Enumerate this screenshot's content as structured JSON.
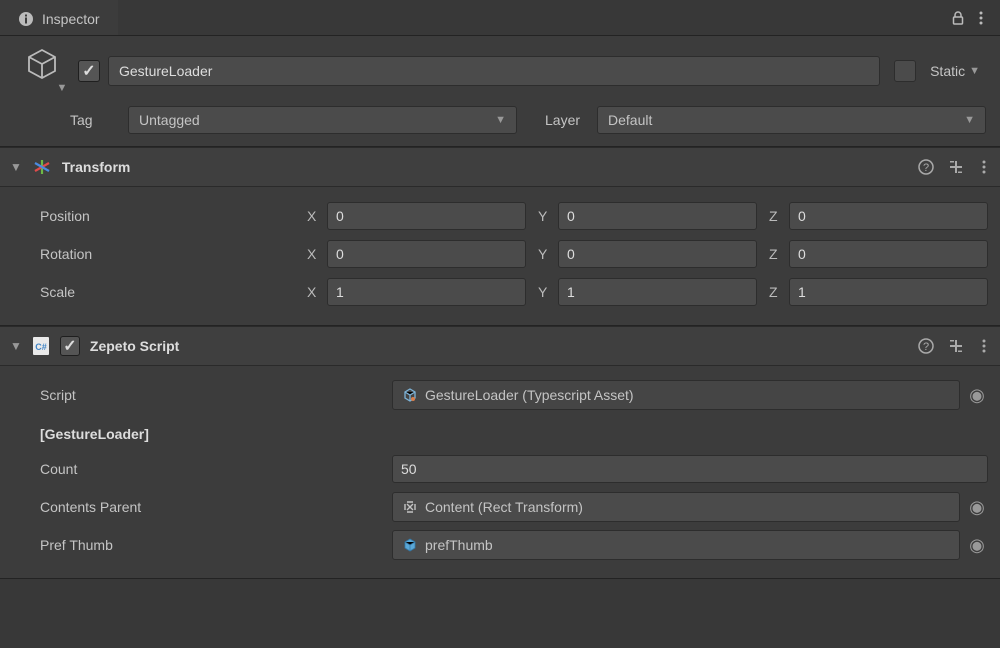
{
  "tab": {
    "title": "Inspector"
  },
  "header": {
    "active": true,
    "name": "GestureLoader",
    "static_label": "Static",
    "tag_label": "Tag",
    "tag_value": "Untagged",
    "layer_label": "Layer",
    "layer_value": "Default"
  },
  "transform": {
    "title": "Transform",
    "rows": [
      {
        "label": "Position",
        "x": "0",
        "y": "0",
        "z": "0"
      },
      {
        "label": "Rotation",
        "x": "0",
        "y": "0",
        "z": "0"
      },
      {
        "label": "Scale",
        "x": "1",
        "y": "1",
        "z": "1"
      }
    ]
  },
  "zepeto": {
    "title": "Zepeto Script",
    "enabled": true,
    "script_label": "Script",
    "script_value": "GestureLoader (Typescript Asset)",
    "section_label": "[GestureLoader]",
    "props": {
      "count_label": "Count",
      "count_value": "50",
      "parent_label": "Contents Parent",
      "parent_value": "Content (Rect Transform)",
      "thumb_label": "Pref Thumb",
      "thumb_value": "prefThumb"
    }
  }
}
